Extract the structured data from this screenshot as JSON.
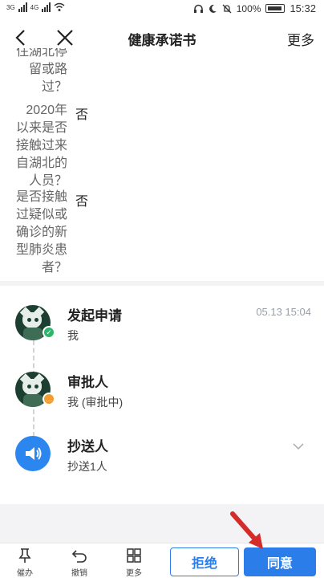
{
  "status": {
    "left": [
      "3G",
      "4G"
    ],
    "battery": "100%",
    "time": "15:32"
  },
  "nav": {
    "title": "健康承诺书",
    "more": "更多"
  },
  "form": {
    "items": [
      {
        "label_lines": [
          "住湖北停",
          "留或路",
          "过？"
        ],
        "value": ""
      },
      {
        "label_lines": [
          "2020年",
          "以来是否",
          "接触过来",
          "自湖北的",
          "人员？"
        ],
        "value": "否"
      },
      {
        "label_lines": [
          "是否接触",
          "过疑似或",
          "确诊的新",
          "型肺炎患",
          "者？"
        ],
        "value": "否"
      }
    ]
  },
  "flow": {
    "steps": [
      {
        "title": "发起申请",
        "sub": "我",
        "time": "05.13 15:04"
      },
      {
        "title": "审批人",
        "sub": "我 (审批中)"
      },
      {
        "title": "抄送人",
        "sub": "抄送1人"
      }
    ]
  },
  "bottom": {
    "tools": [
      {
        "label": "催办",
        "icon": "pin-icon"
      },
      {
        "label": "撤销",
        "icon": "undo-icon"
      },
      {
        "label": "更多",
        "icon": "grid-icon"
      }
    ],
    "reject": "拒绝",
    "agree": "同意"
  },
  "colors": {
    "accent": "#2b7de9",
    "approved": "#2db56b",
    "pending": "#f39b2e",
    "cc": "#2b86f0"
  }
}
